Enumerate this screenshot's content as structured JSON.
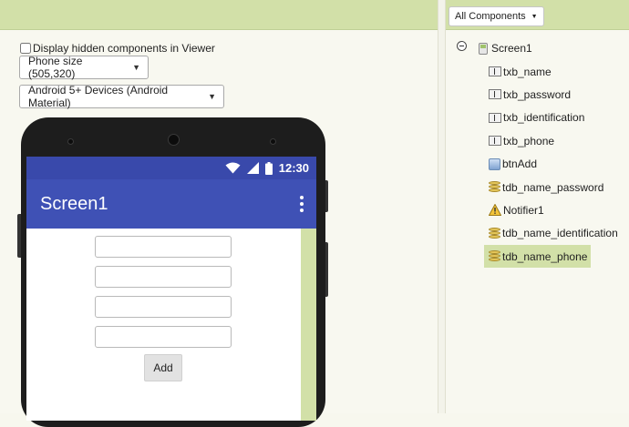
{
  "viewer": {
    "display_hidden_label": "Display hidden components in Viewer",
    "display_hidden_checked": false,
    "size_select": "Phone size (505,320)",
    "theme_select": "Android 5+ Devices (Android Material)"
  },
  "phone": {
    "status_time": "12:30",
    "app_title": "Screen1",
    "textbox_count": 4,
    "add_button_label": "Add"
  },
  "components": {
    "filter_button": "All Components",
    "root": {
      "label": "Screen1",
      "icon": "screen-icon"
    },
    "items": [
      {
        "label": "txb_name",
        "icon": "textbox-icon",
        "selected": false
      },
      {
        "label": "txb_password",
        "icon": "textbox-icon",
        "selected": false
      },
      {
        "label": "txb_identification",
        "icon": "textbox-icon",
        "selected": false
      },
      {
        "label": "txb_phone",
        "icon": "textbox-icon",
        "selected": false
      },
      {
        "label": "btnAdd",
        "icon": "button-icon",
        "selected": false
      },
      {
        "label": "tdb_name_password",
        "icon": "tinydb-icon",
        "selected": false
      },
      {
        "label": "Notifier1",
        "icon": "notifier-icon",
        "selected": false
      },
      {
        "label": "tdb_name_identification",
        "icon": "tinydb-icon",
        "selected": false
      },
      {
        "label": "tdb_name_phone",
        "icon": "tinydb-icon",
        "selected": true
      }
    ]
  },
  "colors": {
    "panel_header": "#d2e0a8",
    "app_bar": "#3f51b5",
    "status_bar": "#3949ab",
    "selection": "#d2e0a8"
  }
}
